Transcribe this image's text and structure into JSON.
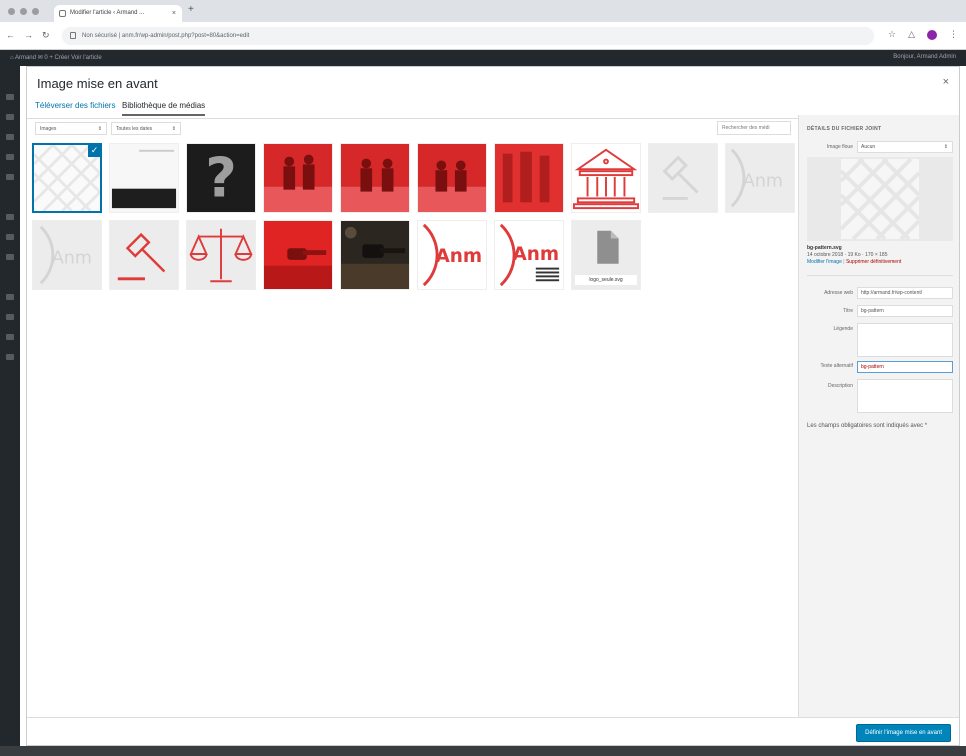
{
  "browser": {
    "tab_title": "Modifier l'article ‹ Armand ...",
    "url": "Non sécurisé | anm.fr/wp-admin/post.php?post=80&action=edit"
  },
  "admin_bar": {
    "left": "⌂ Armand   ✉ 0   + Créer   Voir l'article",
    "right": "Bonjour, Armand Admin"
  },
  "modal": {
    "title": "Image mise en avant",
    "close": "×",
    "tabs": {
      "upload": "Téléverser des fichiers",
      "library": "Bibliothèque de médias"
    },
    "filters": {
      "type": "Images",
      "date": "Toutes les dates"
    },
    "search_placeholder": "Rechercher des médi",
    "attachments": {
      "file_label": "logo_seule.svg"
    },
    "details": {
      "heading": "DÉTAILS DU FICHIER JOINT",
      "size_label": "Image floue",
      "size_value": "Aucun",
      "filename": "bg-pattern.svg",
      "meta": "14 octobre 2018 · 19 Ko · 170 × 185",
      "edit_link": "Modifier l'image",
      "sep": " | ",
      "delete_link": "Supprimer définitivement",
      "fields": {
        "url_label": "Adresse web",
        "url_value": "http://armand.fr/wp-content/",
        "title_label": "Titre",
        "title_value": "bg-pattern",
        "caption_label": "Légende",
        "alt_label": "Texte alternatif",
        "alt_value": "bg-pattern",
        "desc_label": "Description"
      },
      "required_note": "Les champs obligatoires sont indiqués avec *"
    },
    "primary_button": "Définir l'image mise en avant"
  }
}
